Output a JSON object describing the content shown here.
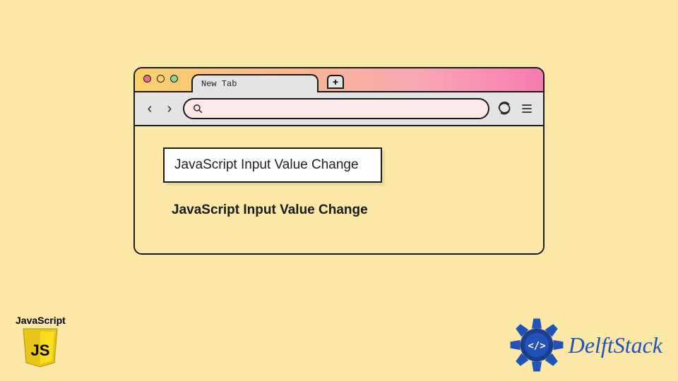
{
  "browser": {
    "tab_label": "New Tab",
    "new_tab_symbol": "+",
    "nav_back": "‹",
    "nav_forward": "›"
  },
  "content": {
    "input_value": "JavaScript Input Value Change",
    "output_text": "JavaScript Input Value Change"
  },
  "logos": {
    "js_label": "JavaScript",
    "js_shield_text": "JS",
    "delft_text": "DelftStack",
    "delft_code": "</>"
  },
  "colors": {
    "page_bg": "#fbe8a6",
    "border": "#1a1a1a",
    "urlbar_bg": "#fce8e8",
    "delft_blue": "#2052b8",
    "js_yellow": "#f7df1e"
  }
}
